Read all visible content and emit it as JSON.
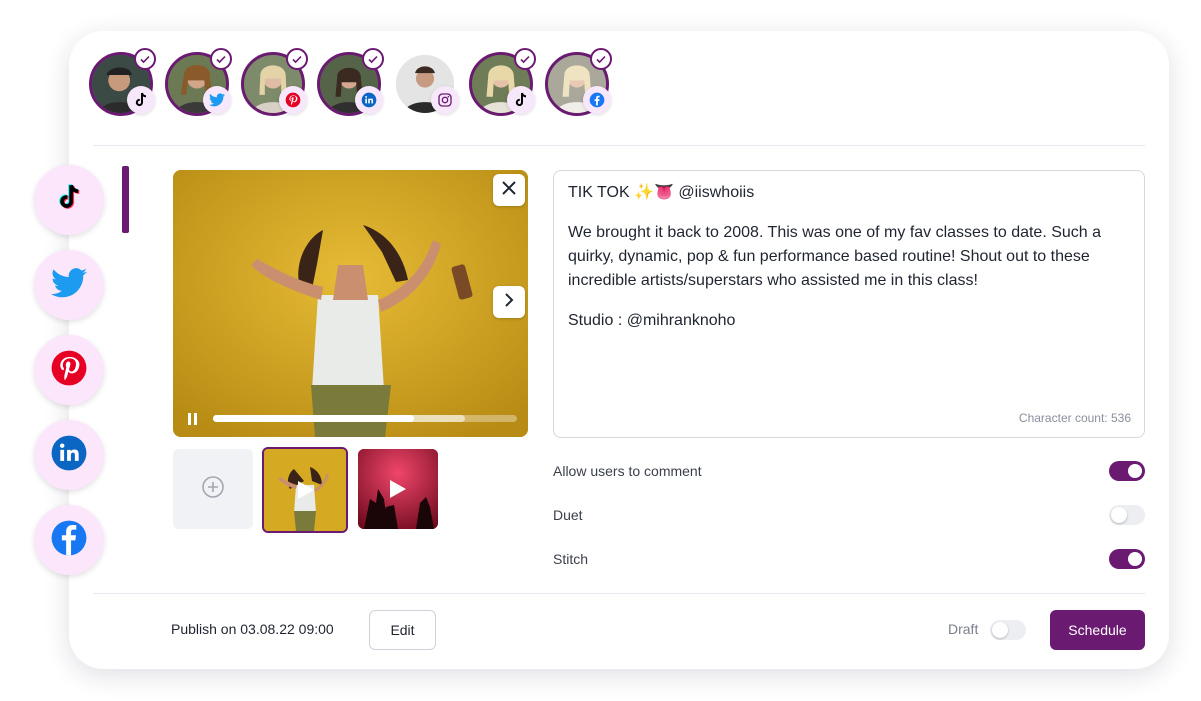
{
  "colors": {
    "accent": "#6b1a72",
    "side_bg": "#fbe6fb"
  },
  "accounts": [
    {
      "network": "tiktok-icon",
      "selected": true
    },
    {
      "network": "twitter-icon",
      "selected": true
    },
    {
      "network": "pinterest-icon",
      "selected": true
    },
    {
      "network": "linkedin-icon",
      "selected": true
    },
    {
      "network": "instagram-icon",
      "selected": false
    },
    {
      "network": "tiktok-icon",
      "selected": true
    },
    {
      "network": "facebook-icon",
      "selected": true
    }
  ],
  "side_networks": [
    "tiktok-icon",
    "twitter-icon",
    "pinterest-icon",
    "linkedin-icon",
    "facebook-icon"
  ],
  "video": {
    "progress": 0.66,
    "buffered": 0.83
  },
  "post": {
    "title": "TIK TOK ✨👅 @iiswhoiis",
    "body": "We brought it back to 2008. This was one of my fav classes to date. Such a quirky, dynamic, pop & fun performance based routine! Shout out to these incredible artists/superstars who assisted me in this class!",
    "studio": "Studio : @mihranknoho",
    "char_count": "Character count: 536"
  },
  "options": [
    {
      "label": "Allow users to comment",
      "on": true
    },
    {
      "label": "Duet",
      "on": false
    },
    {
      "label": "Stitch",
      "on": true
    }
  ],
  "footer": {
    "publish": "Publish on 03.08.22 09:00",
    "edit_label": "Edit",
    "draft_label": "Draft",
    "schedule_label": "Schedule"
  }
}
